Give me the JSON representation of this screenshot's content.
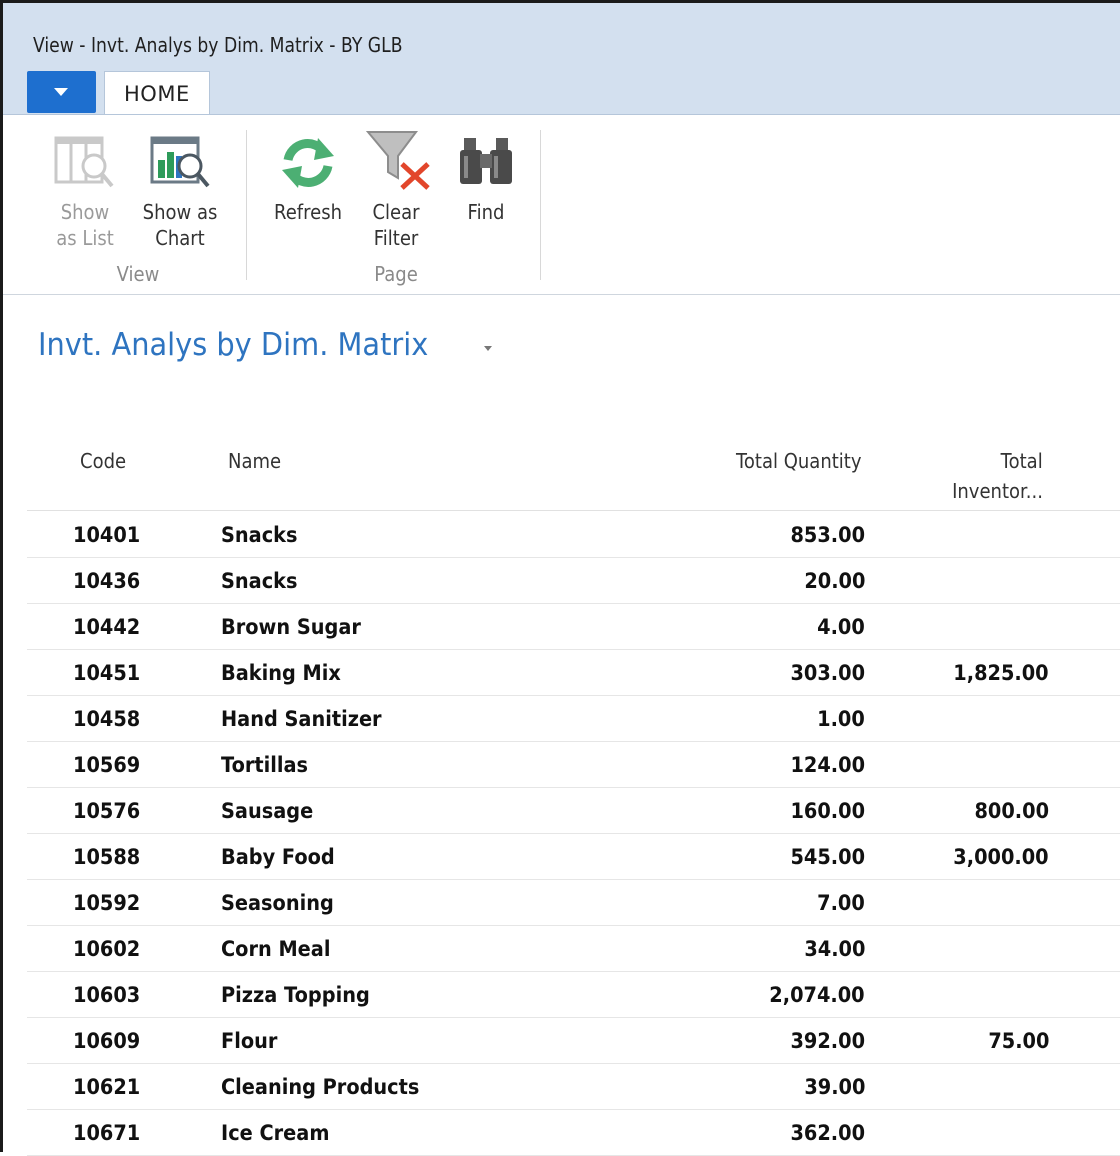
{
  "window": {
    "title": "View - Invt. Analys by Dim. Matrix - BY GLB"
  },
  "ribbon": {
    "tab_home": "HOME",
    "buttons": {
      "show_as_list": [
        "Show",
        "as List"
      ],
      "show_as_chart": [
        "Show as",
        "Chart"
      ],
      "refresh": [
        "Refresh"
      ],
      "clear_filter": [
        "Clear",
        "Filter"
      ],
      "find": [
        "Find"
      ]
    },
    "groups": {
      "view": "View",
      "page": "Page"
    }
  },
  "page": {
    "title": "Invt. Analys by Dim. Matrix"
  },
  "table": {
    "headers": {
      "code": "Code",
      "name": "Name",
      "total_quantity": "Total Quantity",
      "total_inventory_1": "Total",
      "total_inventory_2": "Inventor..."
    },
    "rows": [
      {
        "code": "10401",
        "name": "Snacks",
        "qty": "853.00",
        "inv": ""
      },
      {
        "code": "10436",
        "name": "Snacks",
        "qty": "20.00",
        "inv": ""
      },
      {
        "code": "10442",
        "name": "Brown Sugar",
        "qty": "4.00",
        "inv": ""
      },
      {
        "code": "10451",
        "name": "Baking Mix",
        "qty": "303.00",
        "inv": "1,825.00"
      },
      {
        "code": "10458",
        "name": "Hand Sanitizer",
        "qty": "1.00",
        "inv": ""
      },
      {
        "code": "10569",
        "name": "Tortillas",
        "qty": "124.00",
        "inv": ""
      },
      {
        "code": "10576",
        "name": "Sausage",
        "qty": "160.00",
        "inv": "800.00"
      },
      {
        "code": "10588",
        "name": "Baby Food",
        "qty": "545.00",
        "inv": "3,000.00"
      },
      {
        "code": "10592",
        "name": "Seasoning",
        "qty": "7.00",
        "inv": ""
      },
      {
        "code": "10602",
        "name": "Corn Meal",
        "qty": "34.00",
        "inv": ""
      },
      {
        "code": "10603",
        "name": "Pizza Topping",
        "qty": "2,074.00",
        "inv": ""
      },
      {
        "code": "10609",
        "name": "Flour",
        "qty": "392.00",
        "inv": "75.00"
      },
      {
        "code": "10621",
        "name": "Cleaning Products",
        "qty": "39.00",
        "inv": ""
      },
      {
        "code": "10671",
        "name": "Ice Cream",
        "qty": "362.00",
        "inv": ""
      }
    ]
  },
  "colors": {
    "title_bar": "#d3e0ef",
    "accent_blue": "#1e6fcf",
    "page_title": "#2e74c0",
    "refresh_green": "#4caf73",
    "clear_red": "#e2462b"
  }
}
